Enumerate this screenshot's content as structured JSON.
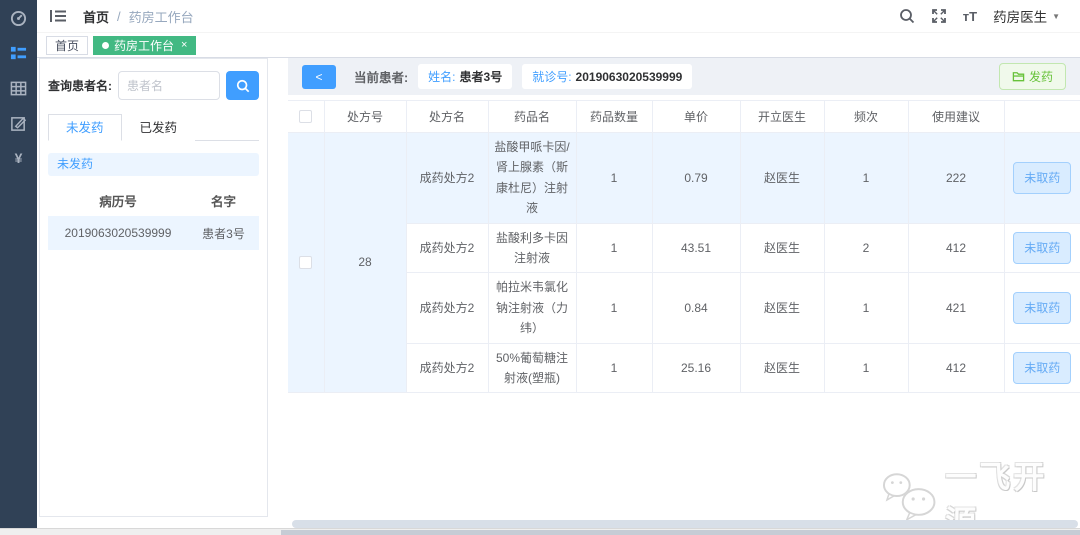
{
  "colors": {
    "primary": "#409eff",
    "sidebar_bg": "#304156",
    "active_tag_green": "#42b983",
    "row_highlight": "#ecf5ff",
    "dispense_green": "#67c23a"
  },
  "sidebar": {
    "icons": [
      {
        "name": "dashboard-icon",
        "active": false
      },
      {
        "name": "worklist-icon",
        "active": true
      },
      {
        "name": "table-icon",
        "active": false
      },
      {
        "name": "form-edit-icon",
        "active": false
      },
      {
        "name": "currency-yuan-icon",
        "active": false,
        "glyph": "¥"
      }
    ]
  },
  "header": {
    "breadcrumb": {
      "root": "首页",
      "separator": "/",
      "current": "药房工作台"
    },
    "font_size_icon_glyph": "тT",
    "user": {
      "name": "药房医生",
      "caret": "▼"
    }
  },
  "tags": [
    {
      "label": "首页",
      "active": false
    },
    {
      "label": "药房工作台",
      "active": true,
      "close": "×"
    }
  ],
  "left_panel": {
    "search_label": "查询患者名:",
    "search_placeholder": "患者名",
    "tabs": [
      {
        "label": "未发药",
        "active": true
      },
      {
        "label": "已发药",
        "active": false
      }
    ],
    "banner": "未发药",
    "table": {
      "headers": [
        "病历号",
        "名字"
      ],
      "rows": [
        {
          "record_no": "2019063020539999",
          "name": "患者3号"
        }
      ]
    }
  },
  "toolbar": {
    "collapse_label": "<",
    "current_patient_label": "当前患者:",
    "name_label": "姓名:",
    "name_value": "患者3号",
    "visit_label": "就诊号:",
    "visit_value": "2019063020539999",
    "dispense_label": "发药"
  },
  "main_table": {
    "headers": [
      "处方号",
      "处方名",
      "药品名",
      "药品数量",
      "单价",
      "开立医生",
      "频次",
      "使用建议"
    ],
    "prescription_no": "28",
    "rows": [
      {
        "presc_name": "成药处方2",
        "drug": "盐酸甲哌卡因/肾上腺素（斯康杜尼）注射液",
        "qty": "1",
        "price": "0.79",
        "doctor": "赵医生",
        "freq": "1",
        "advice": "222",
        "status": "未取药"
      },
      {
        "presc_name": "成药处方2",
        "drug": "盐酸利多卡因注射液",
        "qty": "1",
        "price": "43.51",
        "doctor": "赵医生",
        "freq": "2",
        "advice": "412",
        "status": "未取药"
      },
      {
        "presc_name": "成药处方2",
        "drug": "帕拉米韦氯化钠注射液（力纬）",
        "qty": "1",
        "price": "0.84",
        "doctor": "赵医生",
        "freq": "1",
        "advice": "421",
        "status": "未取药"
      },
      {
        "presc_name": "成药处方2",
        "drug": "50%葡萄糖注射液(塑瓶)",
        "qty": "1",
        "price": "25.16",
        "doctor": "赵医生",
        "freq": "1",
        "advice": "412",
        "status": "未取药"
      }
    ]
  },
  "watermark": {
    "text": "一飞开源"
  }
}
